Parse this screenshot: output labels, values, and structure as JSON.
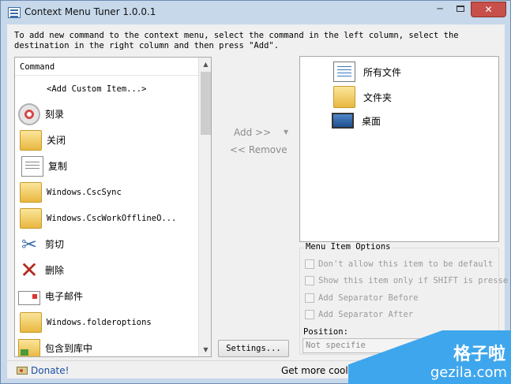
{
  "window": {
    "title": "Context Menu Tuner 1.0.0.1",
    "minimize_glyph": "─",
    "close_glyph": "✕"
  },
  "instructions": "To add new command to the context menu, select the command in the left column, select the destination in the right column and then press \"Add\".",
  "left_list": {
    "header": "Command",
    "items": [
      {
        "label": "<Add Custom Item...>",
        "icon": null
      },
      {
        "label": "刻录",
        "icon": "cd-burn-icon"
      },
      {
        "label": "关闭",
        "icon": "folder-icon"
      },
      {
        "label": "复制",
        "icon": "document-icon"
      },
      {
        "label": "Windows.CscSync",
        "icon": "folder-icon"
      },
      {
        "label": "Windows.CscWorkOfflineO...",
        "icon": "folder-icon"
      },
      {
        "label": "剪切",
        "icon": "scissors-icon"
      },
      {
        "label": "删除",
        "icon": "delete-x-icon"
      },
      {
        "label": "电子邮件",
        "icon": "mail-icon"
      },
      {
        "label": "Windows.folderoptions",
        "icon": "folder-icon"
      },
      {
        "label": "包含到库中",
        "icon": "library-icon"
      }
    ]
  },
  "middle": {
    "add_label": "Add >>",
    "add_dropdown_glyph": "▼",
    "remove_label": "<< Remove"
  },
  "right_list": {
    "items": [
      {
        "label": "所有文件",
        "icon": "all-files-icon"
      },
      {
        "label": "文件夹",
        "icon": "folder-icon"
      },
      {
        "label": "桌面",
        "icon": "desktop-icon"
      }
    ]
  },
  "options": {
    "title": "Menu Item Options",
    "checkboxes": [
      {
        "label": "Don't allow this item to be default",
        "checked": false,
        "enabled": false
      },
      {
        "label": "Show this item only if SHIFT is presse",
        "checked": false,
        "enabled": false
      },
      {
        "label": "Add Separator Before",
        "checked": false,
        "enabled": false
      },
      {
        "label": "Add Separator After",
        "checked": false,
        "enabled": false
      }
    ],
    "position_label": "Position:",
    "position_value": "Not specifie"
  },
  "settings_label": "Settings...",
  "status": {
    "donate_label": "Donate!",
    "more_tools": "Get more cool st"
  },
  "watermark": {
    "cn": "格子啦",
    "en": "gezila.com"
  },
  "colors": {
    "window_frame": "#c6d8ea",
    "close_button": "#c7504b",
    "watermark": "#3ea6ec",
    "link": "#1a4fa0"
  }
}
